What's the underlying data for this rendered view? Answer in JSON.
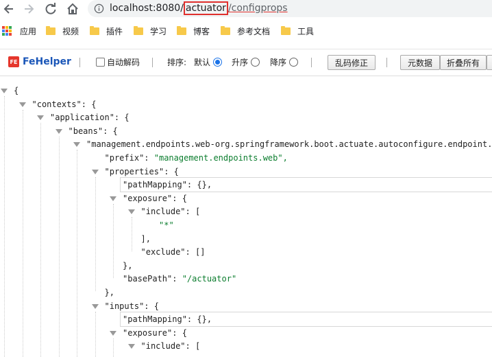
{
  "browser": {
    "url_host": "localhost:8080/",
    "url_seg1": "actuator",
    "url_slash": "/",
    "url_seg2": "configprops"
  },
  "bookmarks": [
    {
      "label": "应用",
      "icon": "apps-icon"
    },
    {
      "label": "视频",
      "icon": "folder-icon"
    },
    {
      "label": "插件",
      "icon": "folder-icon"
    },
    {
      "label": "学习",
      "icon": "folder-icon"
    },
    {
      "label": "博客",
      "icon": "folder-icon"
    },
    {
      "label": "参考文档",
      "icon": "folder-icon"
    },
    {
      "label": "工具",
      "icon": "folder-icon"
    }
  ],
  "fehelper": {
    "logo_text": "FeHelper",
    "logo_mark": "FE",
    "auto_decode_label": "自动解码",
    "sort_label": "排序:",
    "sort_default": "默认",
    "sort_asc": "升序",
    "sort_desc": "降序",
    "fix_garbled_btn": "乱码修正",
    "metadata_btn": "元数据",
    "collapse_all_btn": "折叠所有",
    "selected_sort": "默认"
  },
  "json_lines": [
    {
      "key": "",
      "value": "{"
    },
    {
      "key": "\"contexts\":",
      "value": "{"
    },
    {
      "key": "\"application\":",
      "value": "{"
    },
    {
      "key": "\"beans\":",
      "value": "{"
    },
    {
      "key": "\"management.endpoints.web-org.springframework.boot.actuate.autoconfigure.endpoint.web",
      "value": ""
    },
    {
      "key": "\"prefix\":",
      "value": "\"management.endpoints.web\","
    },
    {
      "key": "\"properties\":",
      "value": "{"
    },
    {
      "key": "\"pathMapping\":",
      "value": "{},"
    },
    {
      "key": "\"exposure\":",
      "value": "{"
    },
    {
      "key": "\"include\":",
      "value": "["
    },
    {
      "key": "",
      "value": "\"*\""
    },
    {
      "key": "",
      "value": "],"
    },
    {
      "key": "\"exclude\":",
      "value": "[]"
    },
    {
      "key": "",
      "value": "},"
    },
    {
      "key": "\"basePath\":",
      "value": "\"/actuator\""
    },
    {
      "key": "",
      "value": "},"
    },
    {
      "key": "\"inputs\":",
      "value": "{"
    },
    {
      "key": "\"pathMapping\":",
      "value": "{},"
    },
    {
      "key": "\"exposure\":",
      "value": "{"
    },
    {
      "key": "\"include\":",
      "value": "["
    }
  ]
}
